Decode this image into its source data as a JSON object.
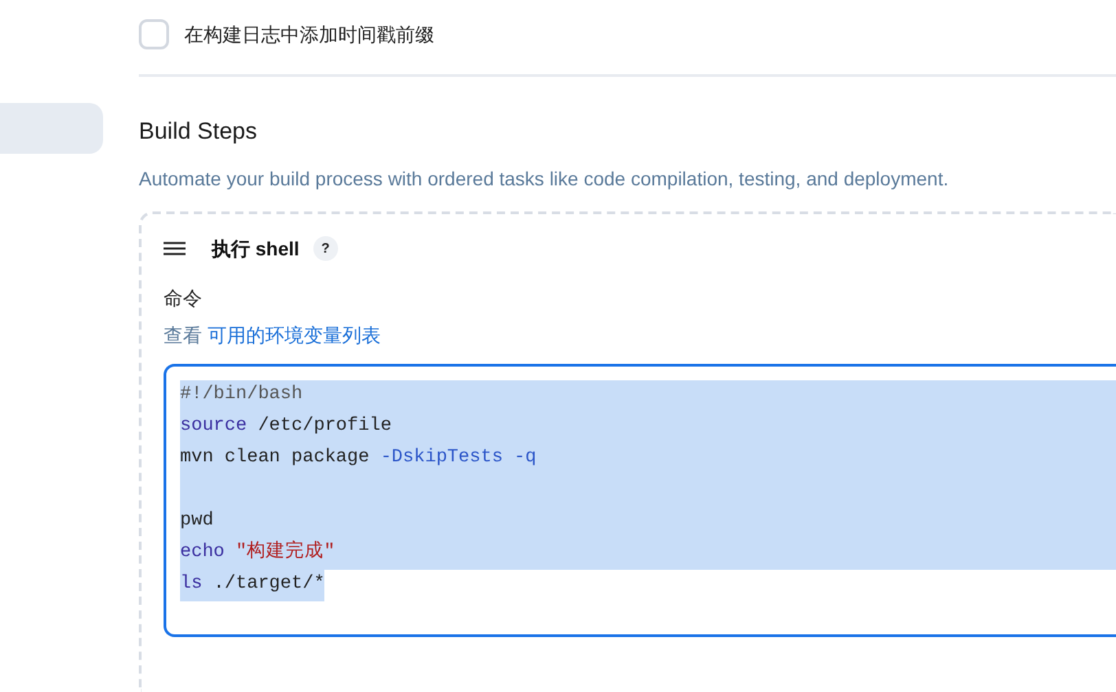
{
  "timestamp_option": {
    "label": "在构建日志中添加时间戳前缀",
    "checked": false
  },
  "sidebar": {
    "items": [
      {
        "selected": true
      }
    ]
  },
  "build_steps": {
    "title": "Build Steps",
    "description": "Automate your build process with ordered tasks like code compilation, testing, and deployment.",
    "step": {
      "title": "执行 shell",
      "help": "?",
      "field_label": "命令",
      "env_link_prefix": "查看",
      "env_link": "可用的环境变量列表",
      "code_lines": [
        {
          "selected": true,
          "tokens": [
            {
              "kind": "comment",
              "text": "#!/bin/bash"
            }
          ]
        },
        {
          "selected": true,
          "tokens": [
            {
              "kind": "keyword",
              "text": "source"
            },
            {
              "kind": "plain",
              "text": " /etc/profile"
            }
          ]
        },
        {
          "selected": true,
          "tokens": [
            {
              "kind": "plain",
              "text": "mvn clean package "
            },
            {
              "kind": "flag",
              "text": "-DskipTests -q"
            }
          ]
        },
        {
          "selected": true
        },
        {
          "selected": true,
          "tokens": [
            {
              "kind": "plain",
              "text": "pwd"
            }
          ]
        },
        {
          "selected": true,
          "tokens": [
            {
              "kind": "keyword",
              "text": "echo"
            },
            {
              "kind": "string",
              "text": " \"构建完成\""
            }
          ]
        },
        {
          "selected": true,
          "selection_ends_here": true,
          "tokens": [
            {
              "kind": "keyword",
              "text": "ls"
            },
            {
              "kind": "plain",
              "text": " ./target/*"
            }
          ]
        }
      ]
    }
  }
}
